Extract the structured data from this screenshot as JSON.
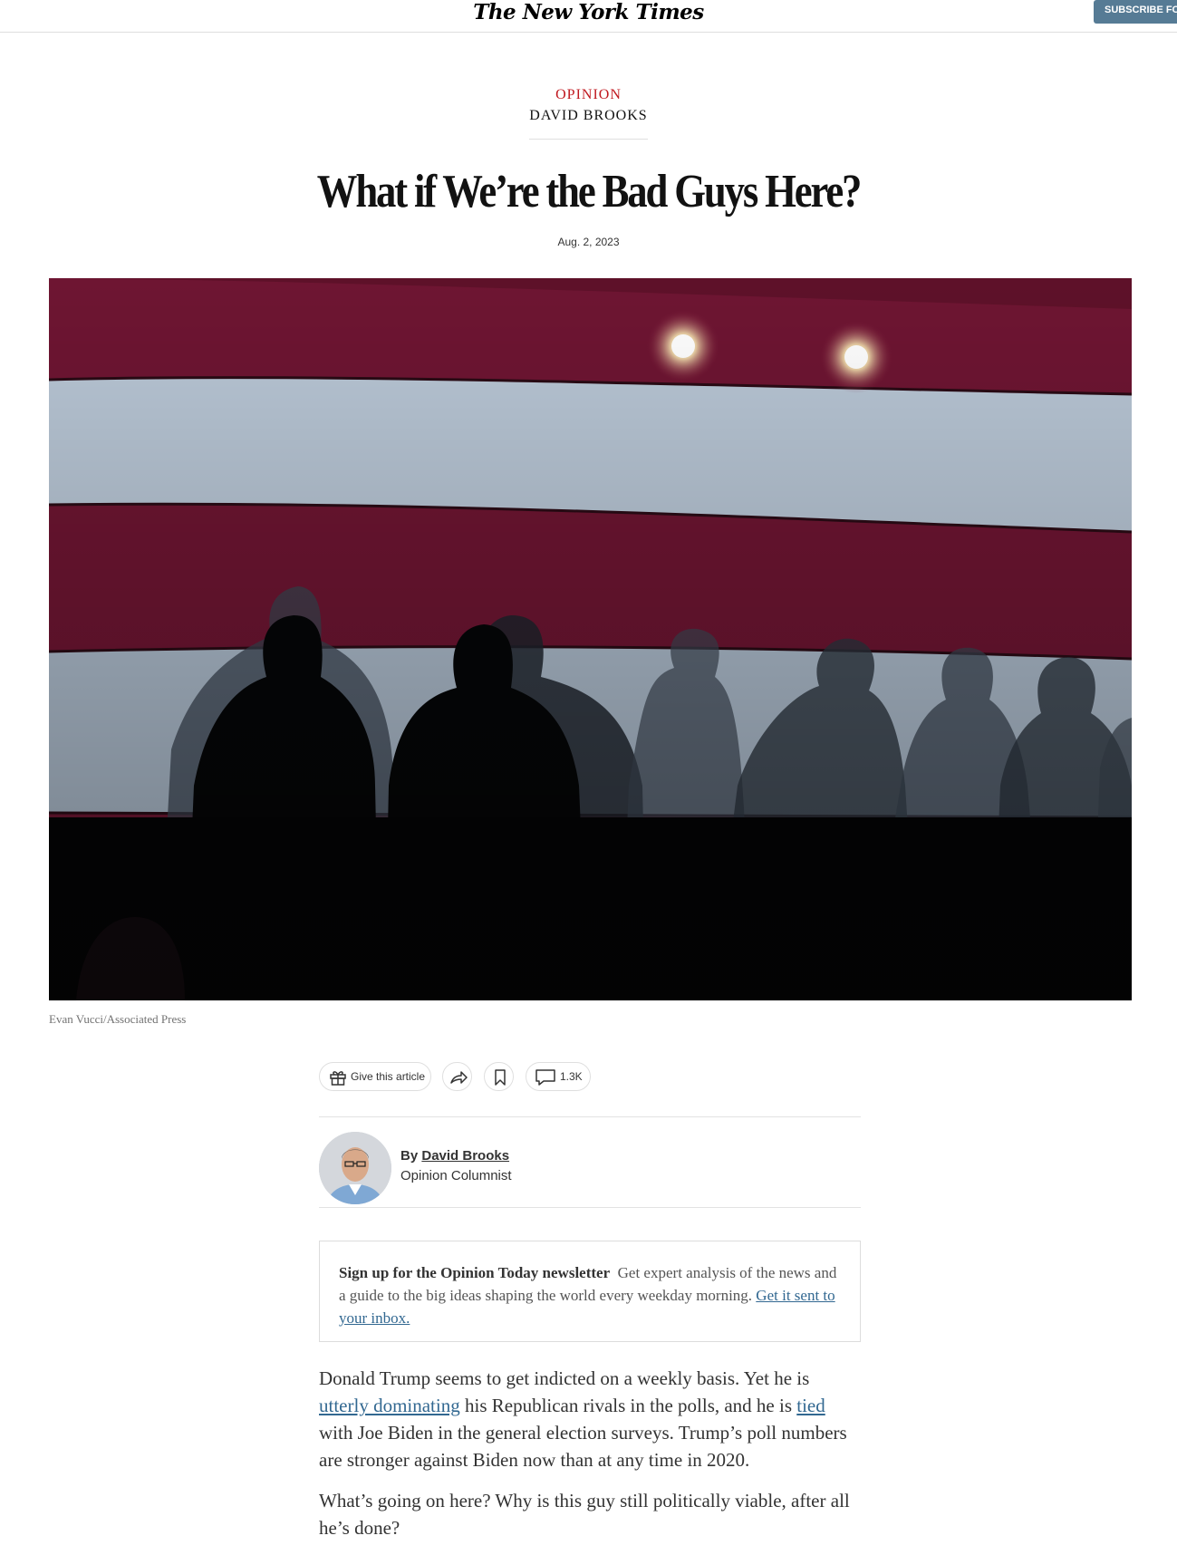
{
  "header": {
    "logo": "The New York Times",
    "subscribe_label": "SUBSCRIBE FO"
  },
  "article": {
    "kicker": "OPINION",
    "author_kicker": "DAVID BROOKS",
    "headline": "What if We’re the Bad Guys Here?",
    "date": "Aug. 2, 2023",
    "photo_credit": "Evan Vucci/Associated Press"
  },
  "toolbar": {
    "gift_label": "Give this article",
    "comments_count": "1.3K",
    "gift_icon": "gift-icon",
    "share_icon": "share-icon",
    "bookmark_icon": "bookmark-icon",
    "comment_icon": "comment-icon"
  },
  "byline": {
    "by": "By",
    "author": "David Brooks",
    "role": "Opinion Columnist"
  },
  "newsletter": {
    "title": "Sign up for the Opinion Today newsletter",
    "description": "Get expert analysis of the news and a guide to the big ideas shaping the world every weekday morning.",
    "link": "Get it sent to your inbox."
  },
  "body": {
    "p1_a": "Donald Trump seems to get indicted on a weekly basis. Yet he is",
    "p1_link1": "utterly dominating",
    "p1_b": "his Republican rivals in the polls, and he is",
    "p1_link2": "tied",
    "p1_c": "with Joe Biden in the general election surveys. Trump’s poll numbers are stronger against Biden now than at any time in 2020.",
    "p2": "What’s going on here? Why is this guy still politically viable, after all he’s done?"
  },
  "colors": {
    "kicker_red": "#c0181f",
    "link_blue": "#326891",
    "subscribe_bg": "#567b95",
    "flag_red": "#7a1737",
    "flag_white": "#b8c6d6"
  }
}
